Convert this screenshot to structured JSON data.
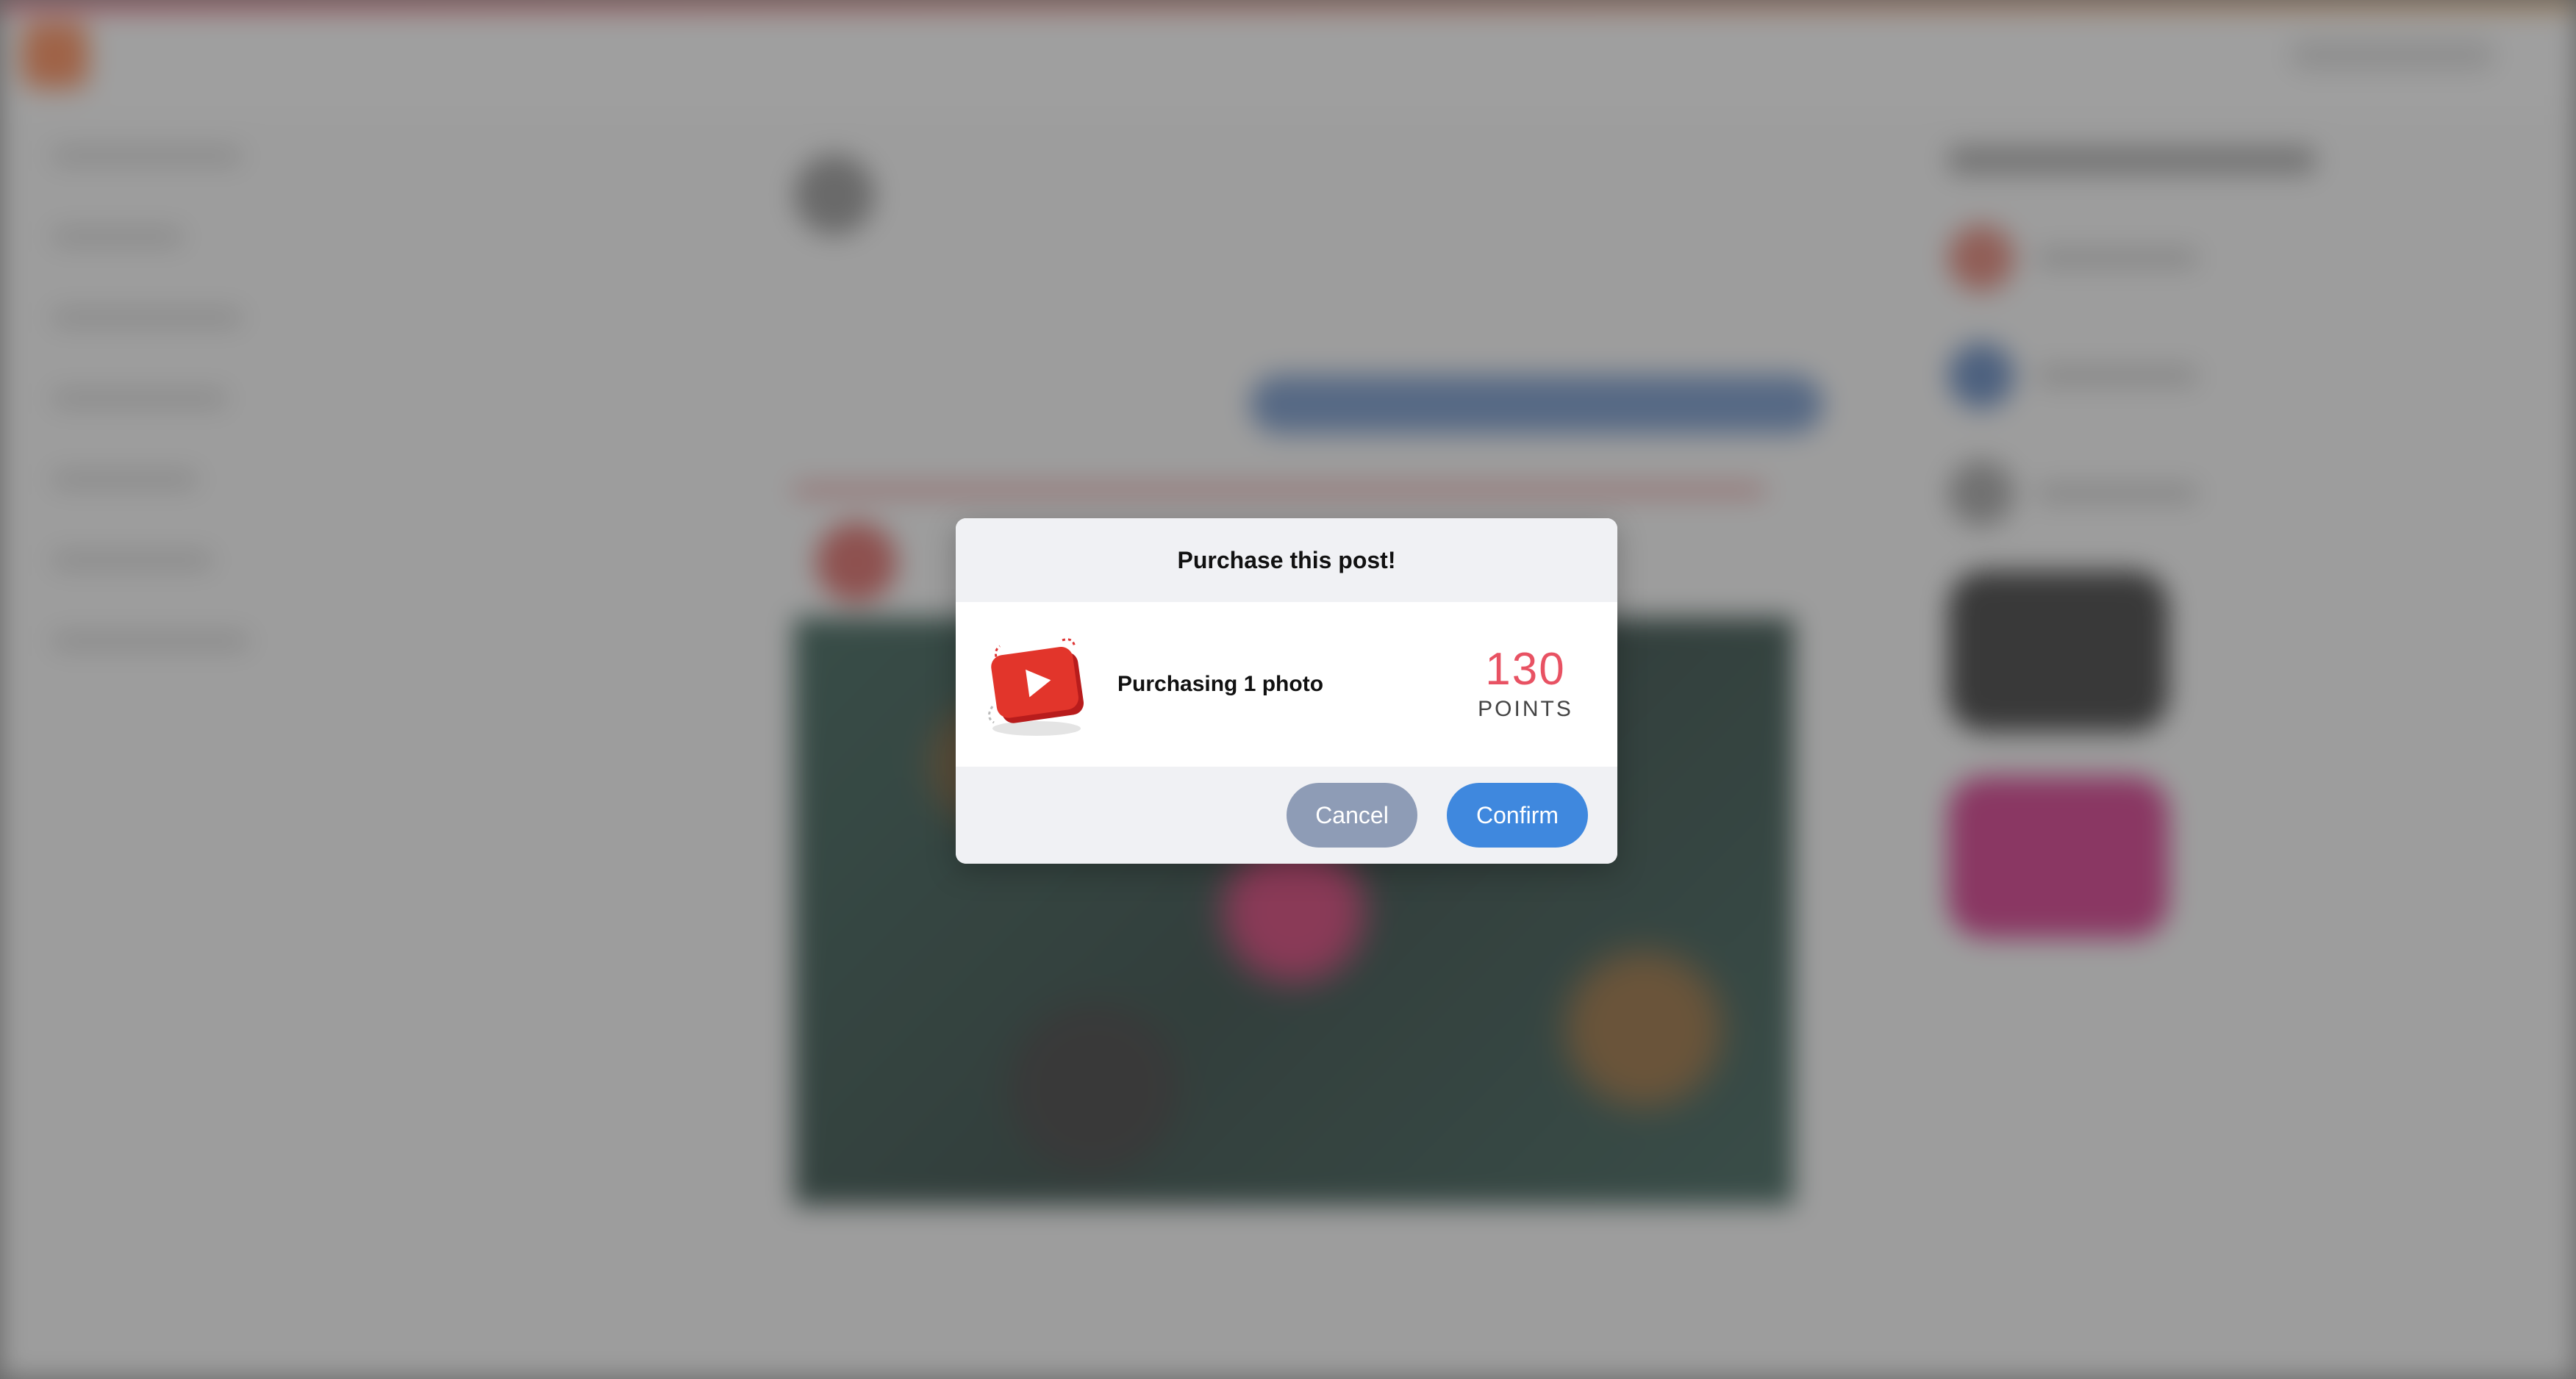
{
  "modal": {
    "title": "Purchase this post!",
    "item_text": "Purchasing 1 photo",
    "price": "130",
    "price_unit": "POINTS",
    "cancel_label": "Cancel",
    "confirm_label": "Confirm",
    "icon": "video-play-icon"
  },
  "colors": {
    "price": "#e85263",
    "confirm_button": "#3f88de",
    "cancel_button": "#8e9cb6",
    "header_bg": "#f0f1f4"
  }
}
